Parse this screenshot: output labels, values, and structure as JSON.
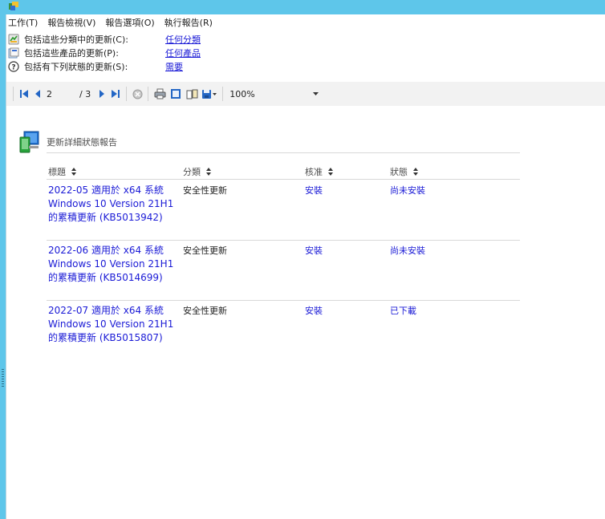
{
  "menu": {
    "items": [
      {
        "label": "工作(T)"
      },
      {
        "label": "報告檢視(V)"
      },
      {
        "label": "報告選項(O)"
      },
      {
        "label": "執行報告(R)"
      }
    ]
  },
  "filters": [
    {
      "label": "包括這些分類中的更新(C):",
      "value": "任何分類",
      "icon": "classification-icon"
    },
    {
      "label": "包括這些產品的更新(P):",
      "value": "任何產品",
      "icon": "product-icon"
    },
    {
      "label": "包括有下列狀態的更新(S):",
      "value": "需要",
      "icon": "help-icon"
    }
  ],
  "toolbar": {
    "current_page": "2",
    "total_pages": "/ 3",
    "zoom": "100%"
  },
  "report": {
    "title": "更新詳細狀態報告",
    "columns": {
      "title": "標題",
      "classification": "分類",
      "approval": "核准",
      "status": "狀態"
    },
    "rows": [
      {
        "title": "2022-05 適用於 x64 系統 Windows 10 Version 21H1 的累積更新 (KB5013942)",
        "classification": "安全性更新",
        "approval": "安裝",
        "status": "尚未安裝"
      },
      {
        "title": "2022-06 適用於 x64 系統 Windows 10 Version 21H1 的累積更新 (KB5014699)",
        "classification": "安全性更新",
        "approval": "安裝",
        "status": "尚未安裝"
      },
      {
        "title": "2022-07 適用於 x64 系統 Windows 10 Version 21H1 的累積更新 (KB5015807)",
        "classification": "安全性更新",
        "approval": "安裝",
        "status": "已下載"
      }
    ]
  },
  "colors": {
    "titlebar": "#5ec6ea",
    "link": "#1a1ad6",
    "toolbar_bg": "#f2f2f2"
  }
}
